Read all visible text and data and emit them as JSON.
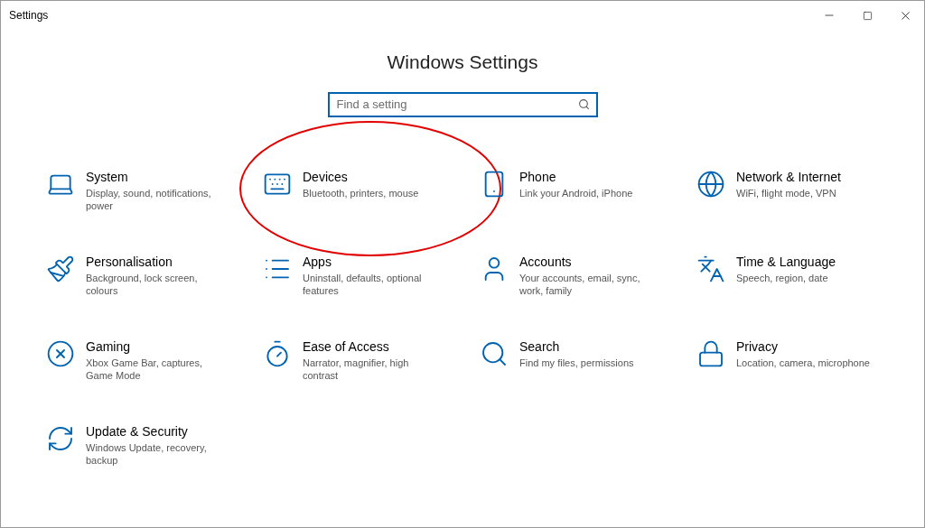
{
  "window": {
    "title": "Settings"
  },
  "heading": "Windows Settings",
  "search": {
    "placeholder": "Find a setting"
  },
  "items": [
    {
      "title": "System",
      "description": "Display, sound, notifications, power",
      "circled": false
    },
    {
      "title": "Devices",
      "description": "Bluetooth, printers, mouse",
      "circled": true
    },
    {
      "title": "Phone",
      "description": "Link your Android, iPhone",
      "circled": false
    },
    {
      "title": "Network & Internet",
      "description": "WiFi, flight mode, VPN",
      "circled": false
    },
    {
      "title": "Personalisation",
      "description": "Background, lock screen, colours",
      "circled": false
    },
    {
      "title": "Apps",
      "description": "Uninstall, defaults, optional features",
      "circled": false
    },
    {
      "title": "Accounts",
      "description": "Your accounts, email, sync, work, family",
      "circled": false
    },
    {
      "title": "Time & Language",
      "description": "Speech, region, date",
      "circled": false
    },
    {
      "title": "Gaming",
      "description": "Xbox Game Bar, captures, Game Mode",
      "circled": false
    },
    {
      "title": "Ease of Access",
      "description": "Narrator, magnifier, high contrast",
      "circled": false
    },
    {
      "title": "Search",
      "description": "Find my files, permissions",
      "circled": false
    },
    {
      "title": "Privacy",
      "description": "Location, camera, microphone",
      "circled": false
    },
    {
      "title": "Update & Security",
      "description": "Windows Update, recovery, backup",
      "circled": false
    }
  ]
}
